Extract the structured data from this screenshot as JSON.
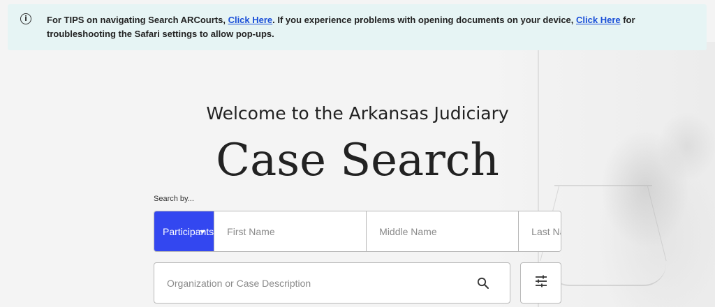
{
  "banner": {
    "text_1": "For TIPS on navigating Search ARCourts, ",
    "link_1": "Click Here",
    "text_2": ". If you experience problems with opening documents on your device, ",
    "link_2": "Click Here",
    "text_3": " for troubleshooting the Safari settings to allow pop-ups.",
    "icon": "info-icon"
  },
  "hero": {
    "welcome": "Welcome to the Arkansas Judiciary",
    "title": "Case Search"
  },
  "search": {
    "search_by_label": "Search by...",
    "mode_selected": "Participants",
    "first_name_placeholder": "First Name",
    "middle_name_placeholder": "Middle Name",
    "last_name_placeholder": "Last Name",
    "org_placeholder": "Organization or Case Description",
    "search_icon": "search-icon",
    "filter_icon": "sliders-icon"
  },
  "colors": {
    "accent": "#3347f0",
    "banner_bg": "#e6f4f4",
    "link": "#1a4fd8"
  }
}
